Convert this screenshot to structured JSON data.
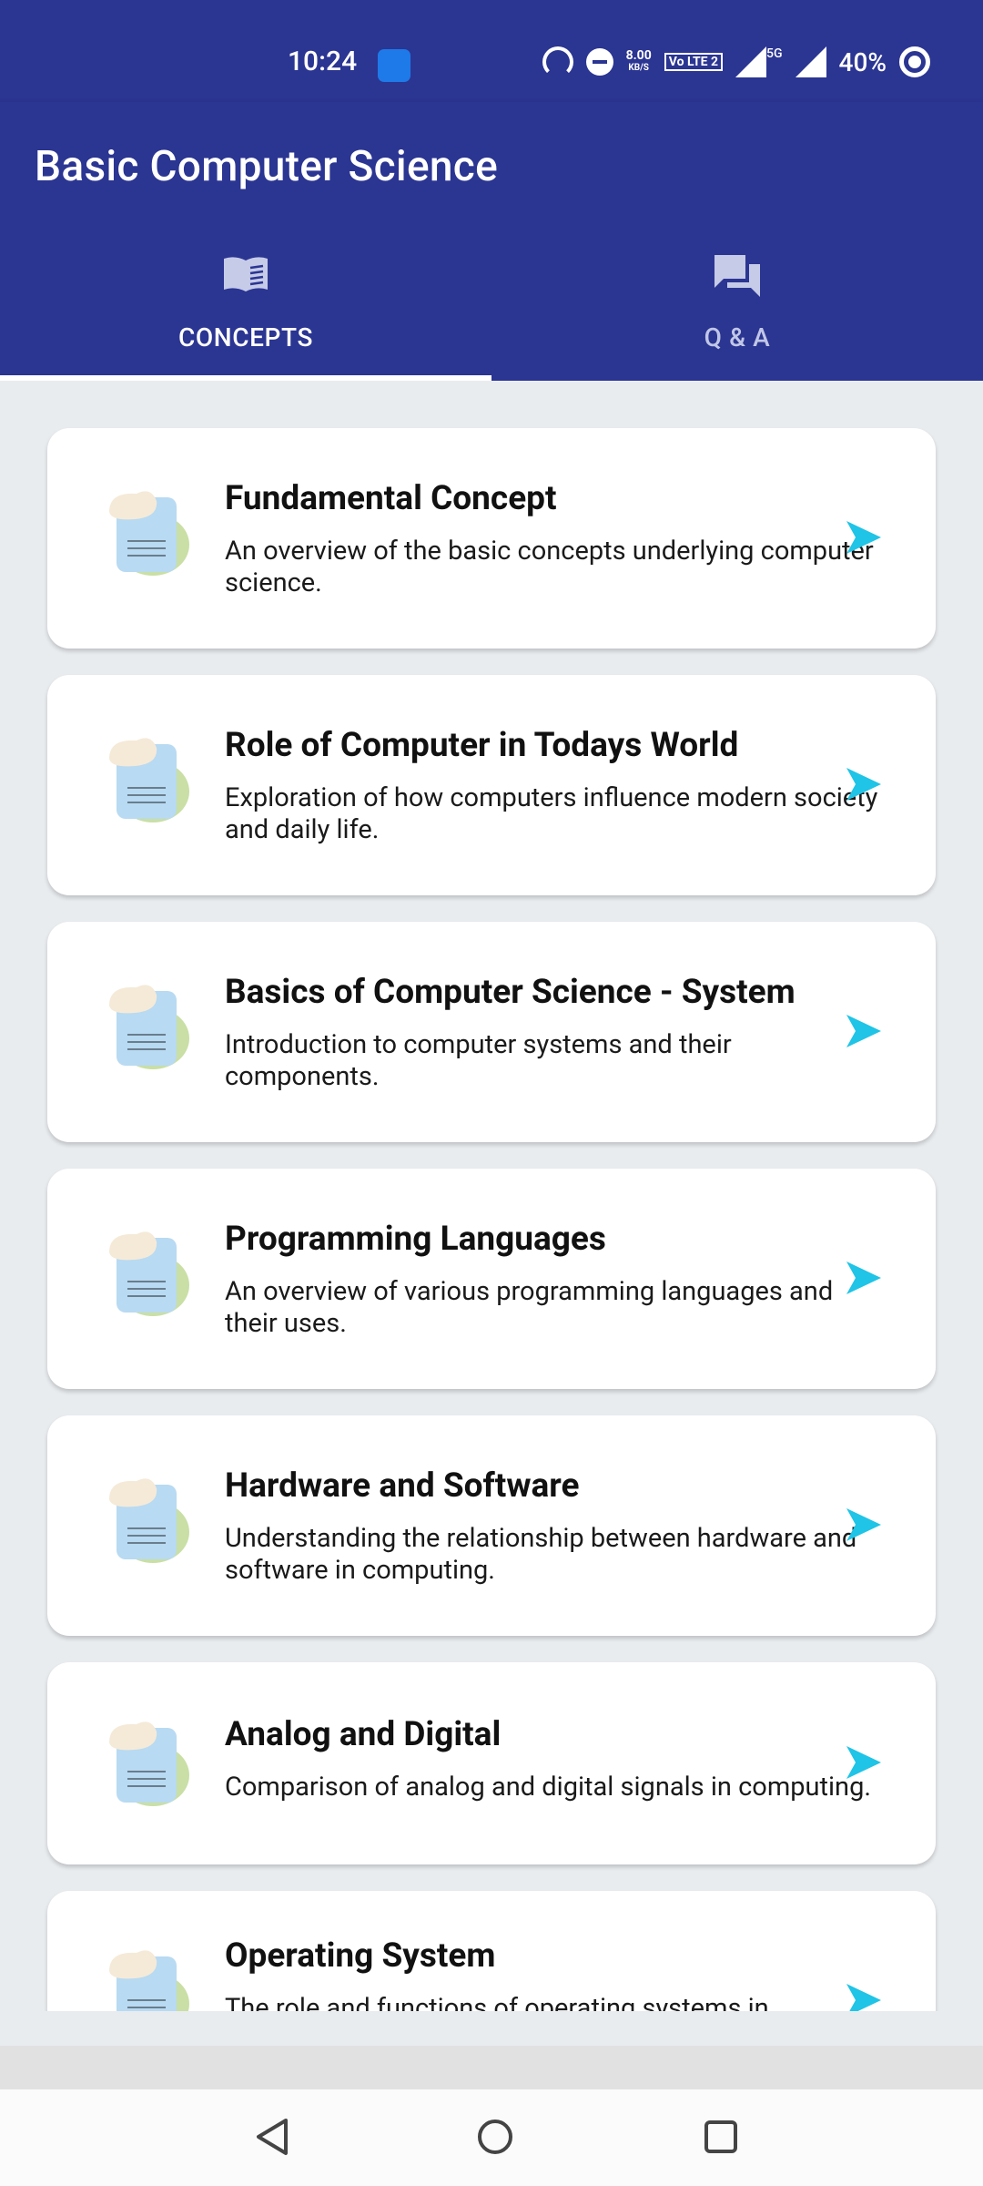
{
  "status_bar": {
    "time": "10:24",
    "net_speed_top": "8.00",
    "net_speed_unit": "KB/S",
    "volte_label": "Vo LTE 2",
    "network_label": "5G",
    "battery_percent": "40%"
  },
  "app_bar": {
    "title": "Basic Computer Science"
  },
  "tabs": [
    {
      "label": "CONCEPTS",
      "icon": "book-icon",
      "selected": true
    },
    {
      "label": "Q & A",
      "icon": "chat-icon",
      "selected": false
    }
  ],
  "topics": [
    {
      "title": "Fundamental Concept",
      "description": "An overview of the basic concepts underlying computer science."
    },
    {
      "title": "Role of Computer in Todays World",
      "description": "Exploration of how computers influence modern society and daily life."
    },
    {
      "title": "Basics of Computer Science - System",
      "description": "Introduction to computer systems and their components."
    },
    {
      "title": "Programming Languages",
      "description": "An overview of various programming languages and their uses."
    },
    {
      "title": "Hardware and Software",
      "description": "Understanding the relationship between hardware and software in computing."
    },
    {
      "title": "Analog and Digital",
      "description": "Comparison of analog and digital signals in computing."
    },
    {
      "title": "Operating System",
      "description": "The role and functions of operating systems in"
    }
  ],
  "colors": {
    "primary": "#2b3592",
    "arrow": "#1fc4e6",
    "background": "#e9ecef"
  },
  "nav_bar": {
    "buttons": [
      "back-icon",
      "home-icon",
      "recents-icon"
    ]
  }
}
